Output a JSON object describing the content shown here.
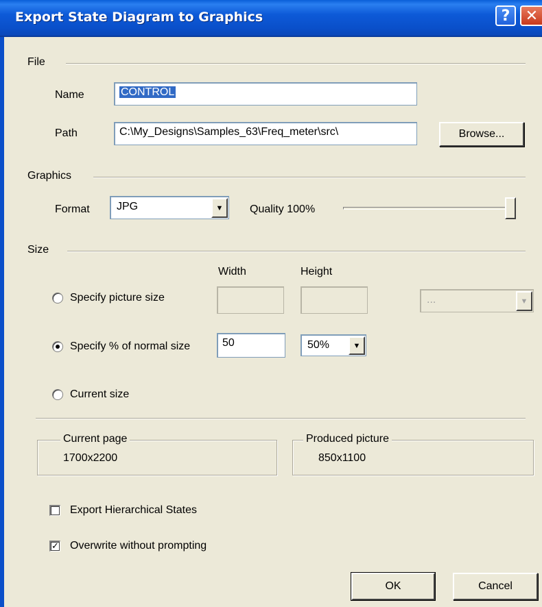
{
  "window": {
    "title": "Export State Diagram to Graphics",
    "help_label": "?",
    "close_label": "✕"
  },
  "file": {
    "group_label": "File",
    "name_label": "Name",
    "name_value": "CONTROL",
    "path_label": "Path",
    "path_value": "C:\\My_Designs\\Samples_63\\Freq_meter\\src\\",
    "browse_label": "Browse..."
  },
  "graphics": {
    "group_label": "Graphics",
    "format_label": "Format",
    "format_value": "JPG",
    "quality_label": "Quality 100%",
    "quality_level": 1.0
  },
  "size": {
    "group_label": "Size",
    "width_header": "Width",
    "height_header": "Height",
    "specify_picture_label": "Specify picture size",
    "specify_picture_checked": false,
    "width_value": "",
    "height_value": "",
    "unit_value": "...",
    "specify_percent_label": "Specify % of normal size",
    "specify_percent_checked": true,
    "percent_value": "50",
    "percent_combo_value": "50%",
    "current_size_label": "Current size",
    "current_size_checked": false
  },
  "current_page": {
    "legend": "Current page",
    "value": "1700x2200"
  },
  "produced_picture": {
    "legend": "Produced picture",
    "value": "850x1100"
  },
  "options": {
    "export_hierarchical_label": "Export Hierarchical States",
    "export_hierarchical_checked": false,
    "overwrite_label": "Overwrite without prompting",
    "overwrite_checked": true
  },
  "buttons": {
    "ok_label": "OK",
    "cancel_label": "Cancel"
  },
  "colors": {
    "title_bar": "#0a5fd8",
    "dialog_bg": "#ece9d8",
    "selection": "#316ac5"
  },
  "icons": {
    "dropdown": "chevron-down-icon",
    "help": "help-icon",
    "close": "close-icon"
  }
}
